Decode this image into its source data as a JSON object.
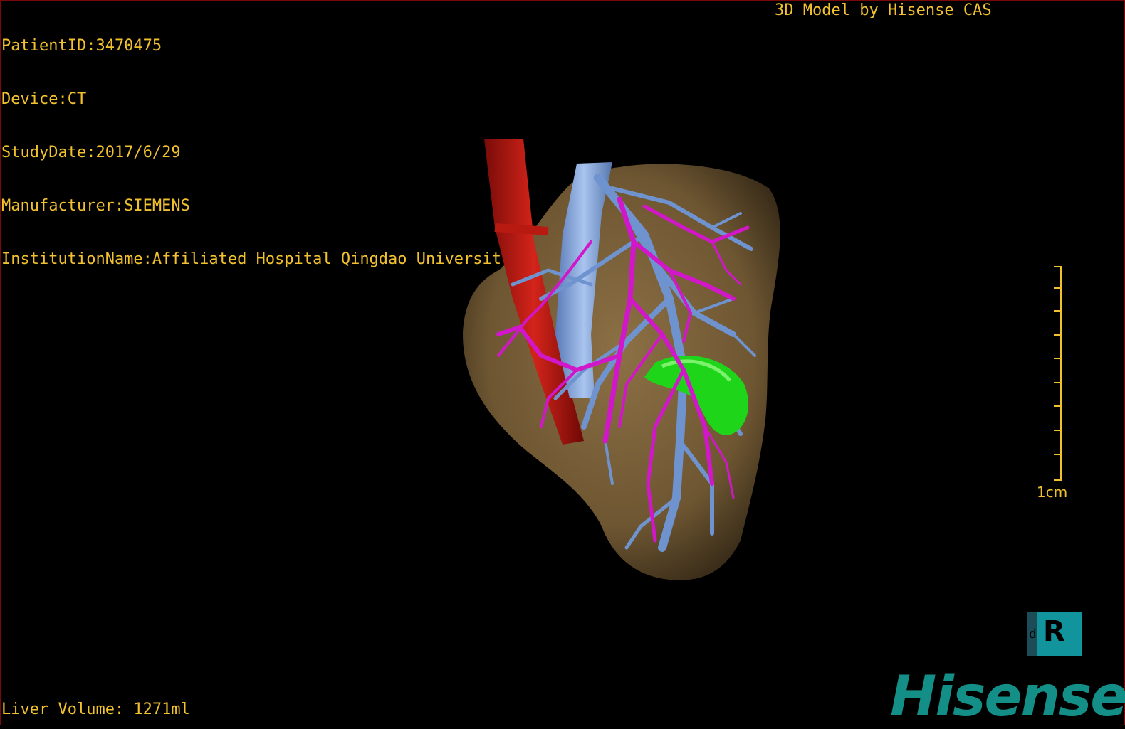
{
  "header": {
    "patient_id": "PatientID:3470475",
    "device": "Device:CT",
    "study_date": "StudyDate:2017/6/29",
    "manufacturer": "Manufacturer:SIEMENS",
    "institution": "InstitutionName:Affiliated Hospital Qingdao University-C"
  },
  "brand_caption": "3D Model by Hisense CAS",
  "footer": {
    "liver_volume": "Liver Volume: 1271ml"
  },
  "scale": {
    "label": "1cm"
  },
  "orientation_cube": {
    "main_glyph": "R",
    "side_glyph": "d"
  },
  "logo": {
    "text": "Hisense"
  },
  "colors": {
    "overlay_text": "#f2c12e",
    "liver": "#7a6038",
    "aorta": "#c21a12",
    "portal_vein": "#6f93cf",
    "hepatic_vein": "#d117c9",
    "gallbladder": "#1fd51a",
    "logo": "#138f88"
  }
}
